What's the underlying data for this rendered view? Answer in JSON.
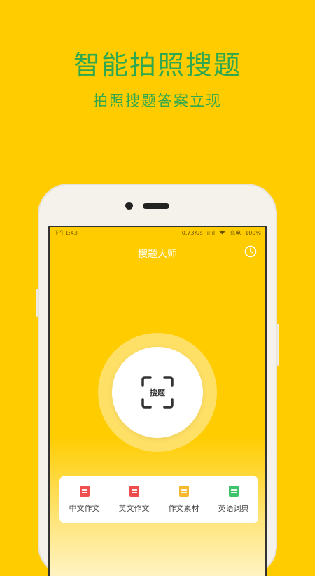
{
  "promo": {
    "title": "智能拍照搜题",
    "subtitle": "拍照搜题答案立现"
  },
  "status_bar": {
    "time": "下午1:43",
    "speed": "0.73K/s",
    "signal": "ıl ıl",
    "battery_label": "充电",
    "battery_percent": "100%"
  },
  "app": {
    "title": "搜题大师",
    "history_icon": "clock-icon"
  },
  "scan": {
    "label": "搜题",
    "icon": "scan-frame-icon"
  },
  "tools": [
    {
      "label": "中文作文",
      "icon": "chinese-essay-icon",
      "color": "#F0504F"
    },
    {
      "label": "英文作文",
      "icon": "english-essay-icon",
      "color": "#EE4D4D"
    },
    {
      "label": "作文素材",
      "icon": "essay-material-icon",
      "color": "#F5B82E"
    },
    {
      "label": "英语词典",
      "icon": "english-dictionary-icon",
      "color": "#3CC36B"
    }
  ],
  "colors": {
    "background": "#FFCC00",
    "promo_text": "#2FA84F",
    "halo": "#FFE066"
  }
}
